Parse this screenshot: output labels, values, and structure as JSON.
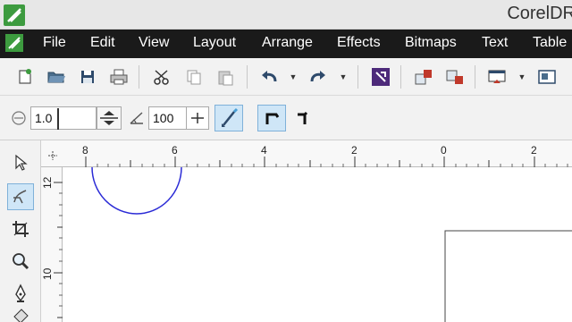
{
  "window": {
    "title": "CorelDR"
  },
  "menu": {
    "items": [
      {
        "label": "File"
      },
      {
        "label": "Edit"
      },
      {
        "label": "View"
      },
      {
        "label": "Layout"
      },
      {
        "label": "Arrange"
      },
      {
        "label": "Effects"
      },
      {
        "label": "Bitmaps"
      },
      {
        "label": "Text"
      },
      {
        "label": "Table"
      }
    ]
  },
  "propbar": {
    "outline_value": "1.0",
    "smoothing_value": "100"
  },
  "ruler": {
    "h_labels": [
      "8",
      "6",
      "4",
      "2",
      "0",
      "2"
    ],
    "v_labels": [
      "12",
      "10"
    ]
  },
  "colors": {
    "curve": "#2b2bd6",
    "accent": "#4a9fd5",
    "brand": "#3d9b3f"
  }
}
